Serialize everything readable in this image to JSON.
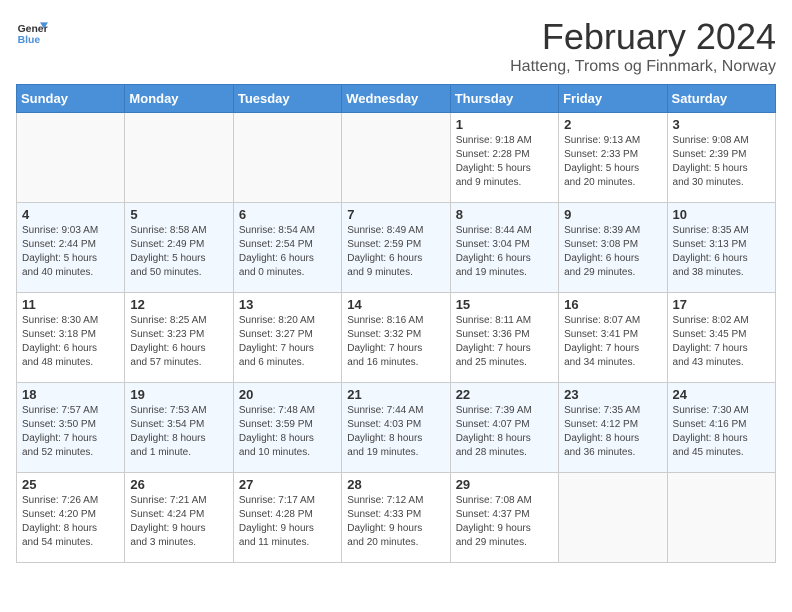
{
  "header": {
    "logo_line1": "General",
    "logo_line2": "Blue",
    "month": "February 2024",
    "location": "Hatteng, Troms og Finnmark, Norway"
  },
  "weekdays": [
    "Sunday",
    "Monday",
    "Tuesday",
    "Wednesday",
    "Thursday",
    "Friday",
    "Saturday"
  ],
  "weeks": [
    [
      {
        "day": "",
        "info": ""
      },
      {
        "day": "",
        "info": ""
      },
      {
        "day": "",
        "info": ""
      },
      {
        "day": "",
        "info": ""
      },
      {
        "day": "1",
        "info": "Sunrise: 9:18 AM\nSunset: 2:28 PM\nDaylight: 5 hours\nand 9 minutes."
      },
      {
        "day": "2",
        "info": "Sunrise: 9:13 AM\nSunset: 2:33 PM\nDaylight: 5 hours\nand 20 minutes."
      },
      {
        "day": "3",
        "info": "Sunrise: 9:08 AM\nSunset: 2:39 PM\nDaylight: 5 hours\nand 30 minutes."
      }
    ],
    [
      {
        "day": "4",
        "info": "Sunrise: 9:03 AM\nSunset: 2:44 PM\nDaylight: 5 hours\nand 40 minutes."
      },
      {
        "day": "5",
        "info": "Sunrise: 8:58 AM\nSunset: 2:49 PM\nDaylight: 5 hours\nand 50 minutes."
      },
      {
        "day": "6",
        "info": "Sunrise: 8:54 AM\nSunset: 2:54 PM\nDaylight: 6 hours\nand 0 minutes."
      },
      {
        "day": "7",
        "info": "Sunrise: 8:49 AM\nSunset: 2:59 PM\nDaylight: 6 hours\nand 9 minutes."
      },
      {
        "day": "8",
        "info": "Sunrise: 8:44 AM\nSunset: 3:04 PM\nDaylight: 6 hours\nand 19 minutes."
      },
      {
        "day": "9",
        "info": "Sunrise: 8:39 AM\nSunset: 3:08 PM\nDaylight: 6 hours\nand 29 minutes."
      },
      {
        "day": "10",
        "info": "Sunrise: 8:35 AM\nSunset: 3:13 PM\nDaylight: 6 hours\nand 38 minutes."
      }
    ],
    [
      {
        "day": "11",
        "info": "Sunrise: 8:30 AM\nSunset: 3:18 PM\nDaylight: 6 hours\nand 48 minutes."
      },
      {
        "day": "12",
        "info": "Sunrise: 8:25 AM\nSunset: 3:23 PM\nDaylight: 6 hours\nand 57 minutes."
      },
      {
        "day": "13",
        "info": "Sunrise: 8:20 AM\nSunset: 3:27 PM\nDaylight: 7 hours\nand 6 minutes."
      },
      {
        "day": "14",
        "info": "Sunrise: 8:16 AM\nSunset: 3:32 PM\nDaylight: 7 hours\nand 16 minutes."
      },
      {
        "day": "15",
        "info": "Sunrise: 8:11 AM\nSunset: 3:36 PM\nDaylight: 7 hours\nand 25 minutes."
      },
      {
        "day": "16",
        "info": "Sunrise: 8:07 AM\nSunset: 3:41 PM\nDaylight: 7 hours\nand 34 minutes."
      },
      {
        "day": "17",
        "info": "Sunrise: 8:02 AM\nSunset: 3:45 PM\nDaylight: 7 hours\nand 43 minutes."
      }
    ],
    [
      {
        "day": "18",
        "info": "Sunrise: 7:57 AM\nSunset: 3:50 PM\nDaylight: 7 hours\nand 52 minutes."
      },
      {
        "day": "19",
        "info": "Sunrise: 7:53 AM\nSunset: 3:54 PM\nDaylight: 8 hours\nand 1 minute."
      },
      {
        "day": "20",
        "info": "Sunrise: 7:48 AM\nSunset: 3:59 PM\nDaylight: 8 hours\nand 10 minutes."
      },
      {
        "day": "21",
        "info": "Sunrise: 7:44 AM\nSunset: 4:03 PM\nDaylight: 8 hours\nand 19 minutes."
      },
      {
        "day": "22",
        "info": "Sunrise: 7:39 AM\nSunset: 4:07 PM\nDaylight: 8 hours\nand 28 minutes."
      },
      {
        "day": "23",
        "info": "Sunrise: 7:35 AM\nSunset: 4:12 PM\nDaylight: 8 hours\nand 36 minutes."
      },
      {
        "day": "24",
        "info": "Sunrise: 7:30 AM\nSunset: 4:16 PM\nDaylight: 8 hours\nand 45 minutes."
      }
    ],
    [
      {
        "day": "25",
        "info": "Sunrise: 7:26 AM\nSunset: 4:20 PM\nDaylight: 8 hours\nand 54 minutes."
      },
      {
        "day": "26",
        "info": "Sunrise: 7:21 AM\nSunset: 4:24 PM\nDaylight: 9 hours\nand 3 minutes."
      },
      {
        "day": "27",
        "info": "Sunrise: 7:17 AM\nSunset: 4:28 PM\nDaylight: 9 hours\nand 11 minutes."
      },
      {
        "day": "28",
        "info": "Sunrise: 7:12 AM\nSunset: 4:33 PM\nDaylight: 9 hours\nand 20 minutes."
      },
      {
        "day": "29",
        "info": "Sunrise: 7:08 AM\nSunset: 4:37 PM\nDaylight: 9 hours\nand 29 minutes."
      },
      {
        "day": "",
        "info": ""
      },
      {
        "day": "",
        "info": ""
      }
    ]
  ]
}
